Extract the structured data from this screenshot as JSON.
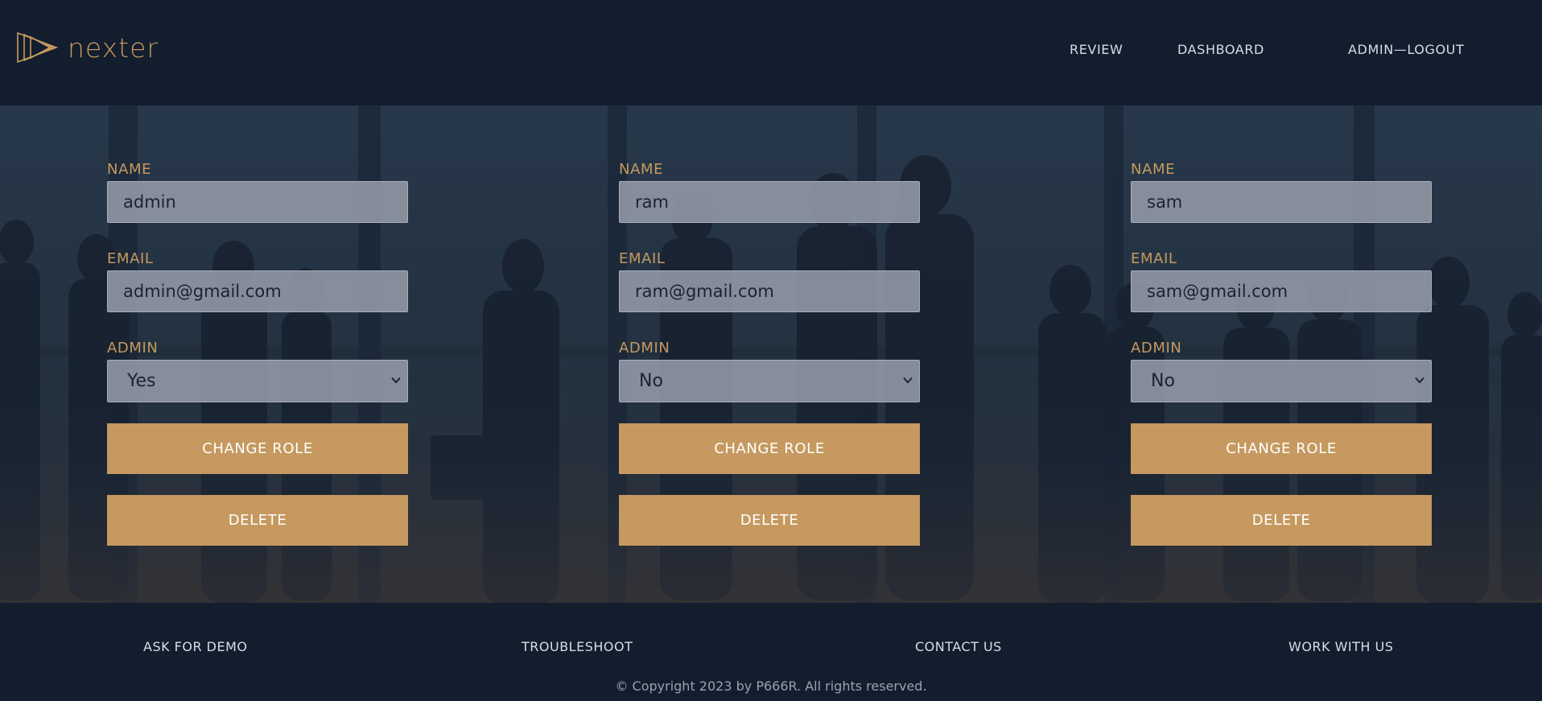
{
  "brand": {
    "name": "nexter"
  },
  "nav": {
    "review": "REVIEW",
    "dashboard": "DASHBOARD",
    "logout": "ADMIN—LOGOUT"
  },
  "labels": {
    "name": "NAME",
    "email": "EMAIL",
    "admin": "ADMIN"
  },
  "users": [
    {
      "name": "admin",
      "email": "admin@gmail.com",
      "admin": "Yes"
    },
    {
      "name": "ram",
      "email": "ram@gmail.com",
      "admin": "No"
    },
    {
      "name": "sam",
      "email": "sam@gmail.com",
      "admin": "No"
    }
  ],
  "buttons": {
    "change_role": "CHANGE ROLE",
    "delete": "DELETE"
  },
  "admin_options": [
    "Yes",
    "No"
  ],
  "footer": {
    "links": [
      "ASK FOR DEMO",
      "TROUBLESHOOT",
      "CONTACT US",
      "WORK WITH US"
    ],
    "copyright": "© Copyright 2023 by P666R. All rights reserved."
  },
  "colors": {
    "accent": "#c5995f",
    "background": "#121d2e",
    "text": "#d9dde3"
  },
  "icons": {
    "logo": "triangle-play-logo-icon",
    "select_arrow": "chevron-down-icon"
  }
}
